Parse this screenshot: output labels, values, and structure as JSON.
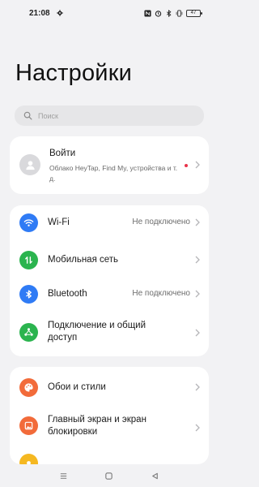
{
  "status_bar": {
    "time": "21:08",
    "battery": "47"
  },
  "page": {
    "title": "Настройки"
  },
  "search": {
    "placeholder": "Поиск"
  },
  "account": {
    "title": "Войти",
    "subtitle": "Облако HeyTap, Find My, устройства и т. д."
  },
  "network": {
    "items": [
      {
        "label": "Wi-Fi",
        "value": "Не подключено",
        "icon": "wifi-icon",
        "color": "#2f7bf5"
      },
      {
        "label": "Мобильная сеть",
        "value": "",
        "icon": "mobile-data-icon",
        "color": "#2bb44f"
      },
      {
        "label": "Bluetooth",
        "value": "Не подключено",
        "icon": "bluetooth-icon",
        "color": "#2f7bf5"
      },
      {
        "label": "Подключение и общий доступ",
        "value": "",
        "icon": "connection-sharing-icon",
        "color": "#2bb44f"
      }
    ]
  },
  "display": {
    "items": [
      {
        "label": "Обои и стили",
        "icon": "palette-icon",
        "color": "#f26b3a"
      },
      {
        "label": "Главный экран и экран блокировки",
        "icon": "home-screen-icon",
        "color": "#f26b3a"
      },
      {
        "label": "",
        "icon": "brightness-icon",
        "color": "#f5b821"
      }
    ]
  },
  "colors": {
    "background": "#f2f2f4",
    "card": "#ffffff",
    "notification_dot": "#e8334a"
  }
}
